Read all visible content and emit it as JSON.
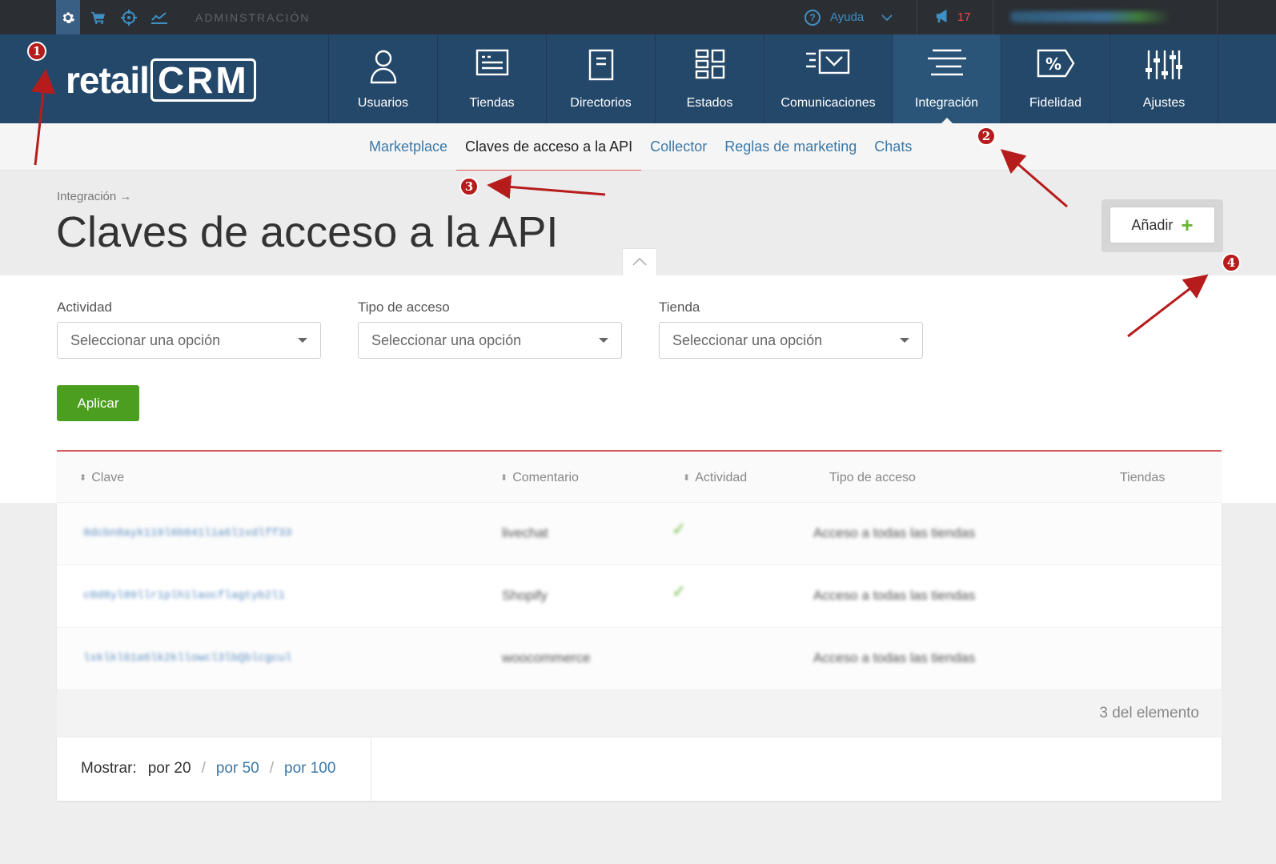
{
  "topbar": {
    "title": "ADMINSTRACIÓN",
    "icons": [
      "gear-icon",
      "cart-icon",
      "crosshair-icon",
      "chart-icon"
    ],
    "help_label": "Ayuda",
    "notifications_count": "17"
  },
  "logo": {
    "word": "retail",
    "crm": "CRM"
  },
  "mainnav": {
    "items": [
      {
        "label": "Usuarios",
        "icon": "user-icon"
      },
      {
        "label": "Tiendas",
        "icon": "store-window-icon"
      },
      {
        "label": "Directorios",
        "icon": "document-icon"
      },
      {
        "label": "Estados",
        "icon": "grid-icon"
      },
      {
        "label": "Comunicaciones",
        "icon": "envelope-icon"
      },
      {
        "label": "Integración",
        "icon": "lines-icon"
      },
      {
        "label": "Fidelidad",
        "icon": "percent-tag-icon"
      },
      {
        "label": "Ajustes",
        "icon": "sliders-icon"
      }
    ],
    "active": "Integración"
  },
  "subnav": {
    "items": [
      "Marketplace",
      "Claves de acceso a la API",
      "Collector",
      "Reglas de marketing",
      "Chats"
    ],
    "active": "Claves de acceso a la API"
  },
  "page": {
    "breadcrumb": "Integración →",
    "title": "Claves de acceso a la API",
    "add_label": "Añadir",
    "add_plus": "+"
  },
  "filters": {
    "actividad_label": "Actividad",
    "tipo_label": "Tipo de acceso",
    "tienda_label": "Tienda",
    "placeholder": "Seleccionar una opción",
    "apply_label": "Aplicar"
  },
  "table": {
    "headers": {
      "clave": "Clave",
      "comentario": "Comentario",
      "actividad": "Actividad",
      "tipo": "Tipo de acceso",
      "tiendas": "Tiendas"
    },
    "rows": [
      {
        "key": "8dcbn8ayk119l6b841l1a6l1vdlff33",
        "comment": "livechat",
        "active": "✓",
        "access": "Acceso a todas las tiendas"
      },
      {
        "key": "c0d8yl09llr1plh1laocflagtyb2l1",
        "comment": "Shopify",
        "active": "✓",
        "access": "Acceso a todas las tiendas"
      },
      {
        "key": "lsklkl61a6lk2kllowcl3lbQblcgcul",
        "comment": "woocommerce",
        "active": "",
        "access": "Acceso a todas las tiendas"
      }
    ]
  },
  "footer": {
    "count": "3 del elemento",
    "show_label": "Mostrar:",
    "per20": "por 20",
    "per50": "por 50",
    "per100": "por 100"
  },
  "annotations": [
    "1",
    "2",
    "3",
    "4"
  ],
  "colors": {
    "topbar": "#2b2f33",
    "nav": "#24486a",
    "accent_red": "#d9595c",
    "apply_green": "#4c9e1f",
    "link_blue": "#3c78a8",
    "annotation_red": "#b71c1c"
  }
}
